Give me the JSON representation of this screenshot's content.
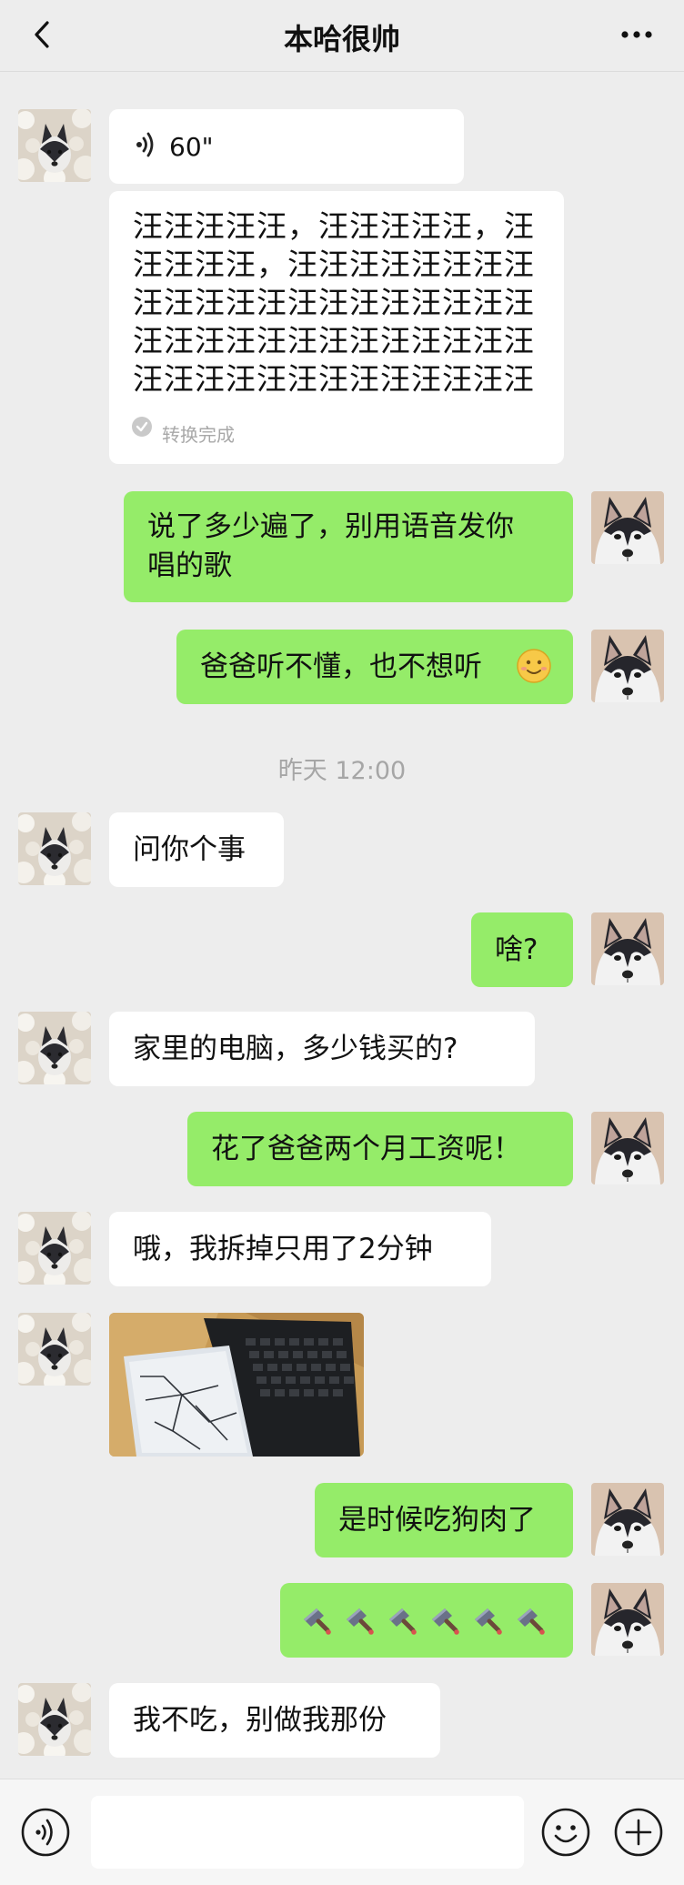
{
  "header": {
    "title": "本哈很帅"
  },
  "messages": {
    "voice": {
      "duration": "60\""
    },
    "transcript": {
      "lines": [
        "汪汪汪汪汪，汪汪汪汪汪，汪",
        "汪汪汪汪，汪汪汪汪汪汪汪汪",
        "汪汪汪汪汪汪汪汪汪汪汪汪汪",
        "汪汪汪汪汪汪汪汪汪汪汪汪汪",
        "汪汪汪汪汪汪汪汪汪汪汪汪汪"
      ],
      "status": "转换完成"
    },
    "m1_line1": "说了多少遍了，别用语音发你",
    "m1_line2": "唱的歌",
    "m2": "爸爸听不懂，也不想听",
    "timestamp": "昨天 12:00",
    "m3": "问你个事",
    "m4": "啥?",
    "m5": "家里的电脑，多少钱买的?",
    "m6": "花了爸爸两个月工资呢！",
    "m7": "哦，我拆掉只用了2分钟",
    "m8": "是时候吃狗肉了",
    "m9": "我不吃，别做我那份"
  },
  "colors": {
    "background": "#ededed",
    "out_bubble": "#95ec69",
    "in_bubble": "#ffffff"
  },
  "icons": [
    "back-chevron-icon",
    "more-dots-icon",
    "voice-wave-icon",
    "check-circle-icon",
    "smile-emoji-icon",
    "cleaver-emoji-icon",
    "voice-input-icon",
    "emoji-icon",
    "plus-icon"
  ]
}
